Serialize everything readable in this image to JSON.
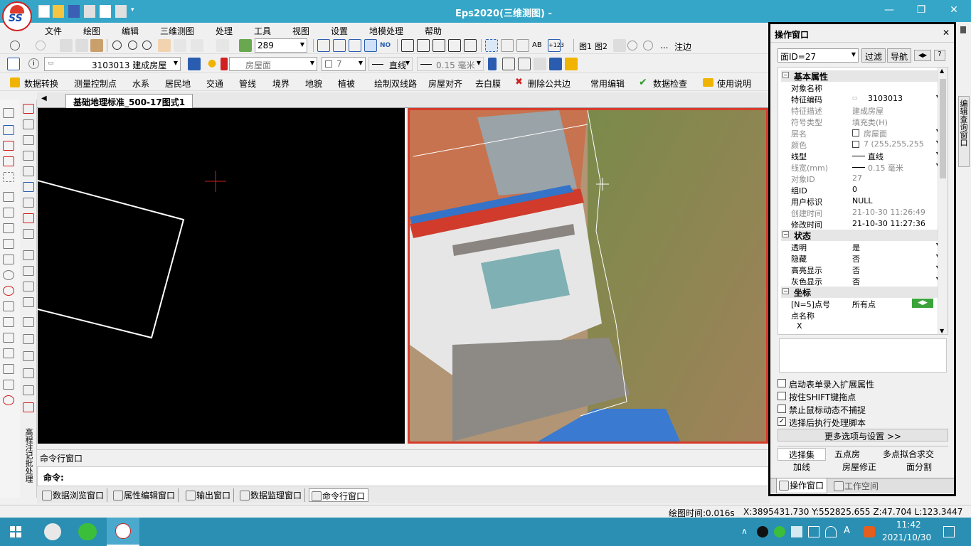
{
  "app": {
    "title": "Eps2020(三维测图) -",
    "logo_text": "SS",
    "window_controls": [
      "—",
      "❐",
      "✕"
    ]
  },
  "menu": [
    "文件",
    "绘图",
    "编辑",
    "三维测图",
    "处理",
    "工具",
    "视图",
    "设置",
    "地模处理",
    "帮助"
  ],
  "toolbar1": {
    "zoom_value": "289",
    "note_label": "注边",
    "map1": "图1",
    "map2": "图2",
    "ellipsis": "..."
  },
  "toolbar2": {
    "feature_code": "3103013 建成房屋",
    "layer": "房屋面",
    "color_value": "7",
    "line_type": "直线",
    "line_width": "0.15 毫米"
  },
  "toolbar3": {
    "items": [
      "数据转换",
      "测量控制点",
      "水系",
      "居民地",
      "交通",
      "管线",
      "境界",
      "地貌",
      "植被",
      "绘制双线路",
      "房屋对齐",
      "去白膜",
      "删除公共边",
      "常用编辑",
      "数据检查",
      "使用说明"
    ]
  },
  "left_vertical_label": "高程注记批处理",
  "doc_tab": "基础地理标准_500-17图式1",
  "command": {
    "window_title": "命令行窗口",
    "prompt": "命令:"
  },
  "bottom_tabs": [
    "数据浏览窗口",
    "属性编辑窗口",
    "输出窗口",
    "数据监理窗口",
    "命令行窗口"
  ],
  "status": {
    "draw_time": "绘图时间:0.016s",
    "coords": "X:3895431.730 Y:552825.655 Z:47.704 L:123.3447"
  },
  "panel": {
    "title": "操作窗口",
    "close": "✕",
    "object_select": "面ID=27",
    "filter_button": "过滤",
    "nav_button": "导航",
    "help_button": "?",
    "groups": {
      "basic": "基本属性",
      "state": "状态",
      "coord": "坐标"
    },
    "basic_rows": [
      {
        "k": "对象名称",
        "v": ""
      },
      {
        "k": "特征编码",
        "v": "3103013"
      },
      {
        "k": "特征描述",
        "v": "建成房屋"
      },
      {
        "k": "符号类型",
        "v": "填充类(H)"
      },
      {
        "k": "层名",
        "v": "房屋面"
      },
      {
        "k": "颜色",
        "v": "7 (255,255,255"
      },
      {
        "k": "线型",
        "v": "直线"
      },
      {
        "k": "线宽(mm)",
        "v": "0.15 毫米"
      },
      {
        "k": "对象ID",
        "v": "27"
      },
      {
        "k": "组ID",
        "v": "0"
      },
      {
        "k": "用户标识",
        "v": "NULL"
      },
      {
        "k": "创建时间",
        "v": "21-10-30 11:26:49"
      },
      {
        "k": "修改时间",
        "v": "21-10-30 11:27:36"
      }
    ],
    "state_rows": [
      {
        "k": "透明",
        "v": "是"
      },
      {
        "k": "隐藏",
        "v": "否"
      },
      {
        "k": "高亮显示",
        "v": "否"
      },
      {
        "k": "灰色显示",
        "v": "否"
      }
    ],
    "coord_rows": [
      {
        "k": "[N=5]点号",
        "v": "所有点"
      },
      {
        "k": "点名称",
        "v": ""
      },
      {
        "k": "X",
        "v": ""
      }
    ],
    "checks": [
      {
        "label": "启动表单录入扩展属性",
        "checked": false
      },
      {
        "label": "按住SHIFT键拖点",
        "checked": false
      },
      {
        "label": "禁止鼠标动态不捕捉",
        "checked": false
      },
      {
        "label": "选择后执行处理脚本",
        "checked": true
      }
    ],
    "more_options": "更多选项与设置 >>",
    "func_tabs_row1": [
      "选择集",
      "五点房",
      "多点拟合求交"
    ],
    "func_tabs_row2": [
      "加线",
      "房屋修正",
      "面分割"
    ],
    "bottom_tabs": [
      "操作窗口",
      "工作空间"
    ]
  },
  "right_side_label": "编辑查询窗口",
  "taskbar": {
    "time": "11:42",
    "date": "2021/10/30",
    "ime": "A"
  }
}
